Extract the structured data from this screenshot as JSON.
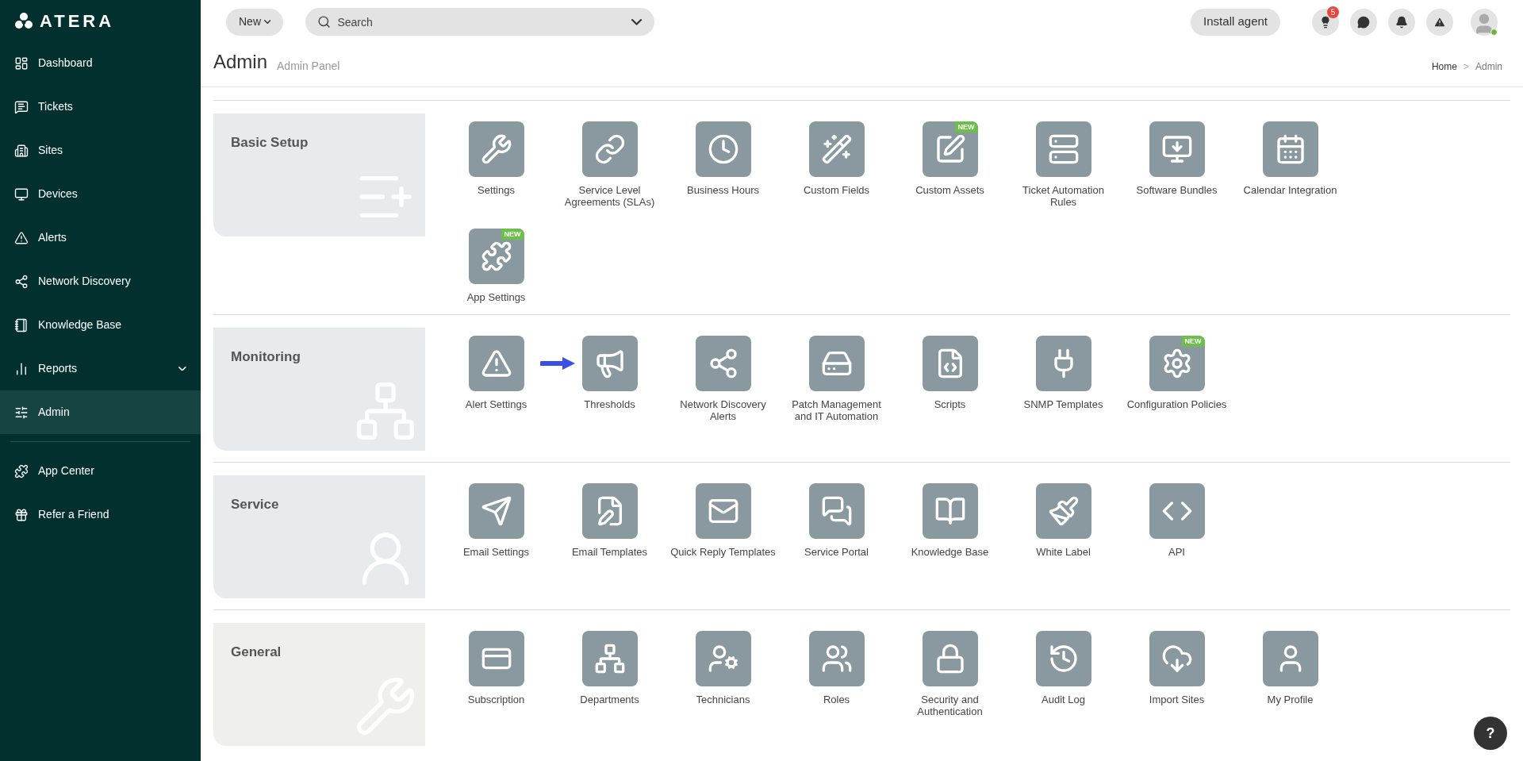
{
  "sidebar": {
    "logo": "ATERA",
    "items": [
      {
        "label": "Dashboard",
        "selected": false,
        "submenu": false
      },
      {
        "label": "Tickets",
        "selected": false,
        "submenu": false
      },
      {
        "label": "Sites",
        "selected": false,
        "submenu": false
      },
      {
        "label": "Devices",
        "selected": false,
        "submenu": false
      },
      {
        "label": "Alerts",
        "selected": false,
        "submenu": false
      },
      {
        "label": "Network Discovery",
        "selected": false,
        "submenu": false
      },
      {
        "label": "Knowledge Base",
        "selected": false,
        "submenu": false
      },
      {
        "label": "Reports",
        "selected": false,
        "submenu": true
      },
      {
        "label": "Admin",
        "selected": true,
        "submenu": false
      }
    ],
    "bottom_items": [
      {
        "label": "App Center",
        "selected": false
      },
      {
        "label": "Refer a Friend",
        "selected": false
      }
    ]
  },
  "topbar": {
    "new_button": "New",
    "search": {
      "placeholder": "Search"
    },
    "install_button": "Install agent",
    "tips_badge": "5"
  },
  "header": {
    "title": "Admin",
    "subtitle": "Admin Panel",
    "breadcrumb": [
      "Home",
      "Admin"
    ],
    "breadcrumb_separator": ">"
  },
  "sections": [
    {
      "title": "Basic Setup",
      "tiles": [
        {
          "kind": "tile",
          "label": "Settings"
        },
        {
          "kind": "tile",
          "label": "Service Level Agreements (SLAs)"
        },
        {
          "kind": "tile",
          "label": "Business Hours"
        },
        {
          "kind": "tile",
          "label": "Custom Fields"
        },
        {
          "kind": "tile",
          "label": "Custom Assets",
          "badge": "NEW"
        },
        {
          "kind": "tile",
          "label": "Ticket Automation Rules"
        },
        {
          "kind": "tile",
          "label": "Software Bundles"
        },
        {
          "kind": "tile",
          "label": "Calendar Integration"
        },
        {
          "kind": "tile",
          "label": "App Settings",
          "badge": "NEW"
        }
      ]
    },
    {
      "title": "Monitoring",
      "tiles": [
        {
          "kind": "tile",
          "label": "Alert Settings"
        },
        {
          "kind": "arrow"
        },
        {
          "kind": "tile",
          "label": "Thresholds"
        },
        {
          "kind": "tile",
          "label": "Network Discovery Alerts"
        },
        {
          "kind": "tile",
          "label": "Patch Management and IT Automation"
        },
        {
          "kind": "tile",
          "label": "Scripts"
        },
        {
          "kind": "tile",
          "label": "SNMP Templates"
        },
        {
          "kind": "tile",
          "label": "Configuration Policies",
          "badge": "NEW"
        }
      ]
    },
    {
      "title": "Service",
      "tiles": [
        {
          "kind": "tile",
          "label": "Email Settings"
        },
        {
          "kind": "tile",
          "label": "Email Templates"
        },
        {
          "kind": "tile",
          "label": "Quick Reply Templates"
        },
        {
          "kind": "tile",
          "label": "Service Portal"
        },
        {
          "kind": "tile",
          "label": "Knowledge Base"
        },
        {
          "kind": "tile",
          "label": "White Label"
        },
        {
          "kind": "tile",
          "label": "API"
        }
      ]
    },
    {
      "title": "General",
      "tiles": [
        {
          "kind": "tile",
          "label": "Subscription"
        },
        {
          "kind": "tile",
          "label": "Departments"
        },
        {
          "kind": "tile",
          "label": "Technicians"
        },
        {
          "kind": "tile",
          "label": "Roles"
        },
        {
          "kind": "tile",
          "label": "Security and Authentication"
        },
        {
          "kind": "tile",
          "label": "Audit Log"
        },
        {
          "kind": "tile",
          "label": "Import Sites"
        },
        {
          "kind": "tile",
          "label": "My Profile"
        }
      ]
    }
  ],
  "help_button": "?"
}
